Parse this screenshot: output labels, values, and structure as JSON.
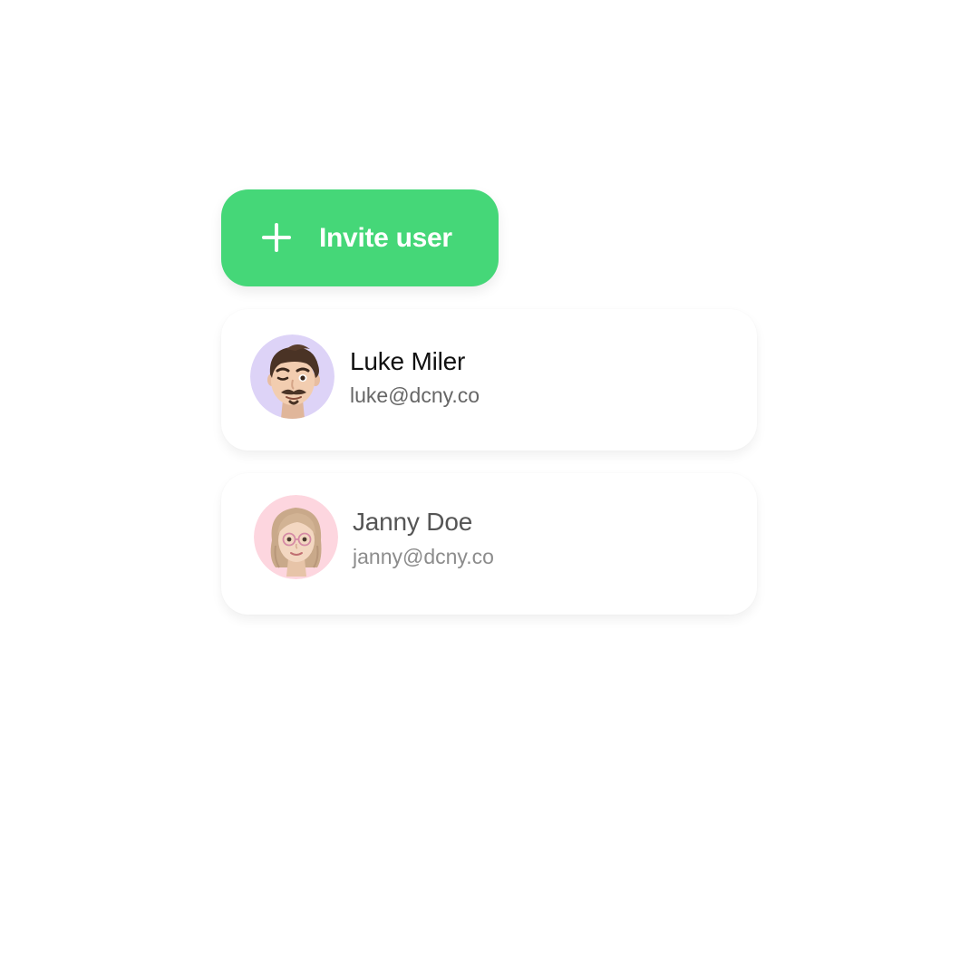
{
  "colors": {
    "accent": "#45d778",
    "background": "#ffffff",
    "name_primary": "#111111",
    "name_muted": "#555555",
    "email_primary": "#666666",
    "email_muted": "#8c8c8c"
  },
  "invite_button": {
    "icon": "plus-icon",
    "label": "Invite user"
  },
  "users": [
    {
      "name": "Luke Miler",
      "email": "luke@dcny.co",
      "avatar_icon": "memoji-man-winking-icon",
      "avatar_bg": "#ddd3f7"
    },
    {
      "name": "Janny Doe",
      "email": "janny@dcny.co",
      "avatar_icon": "memoji-woman-glasses-icon",
      "avatar_bg": "#fdd6df"
    }
  ]
}
